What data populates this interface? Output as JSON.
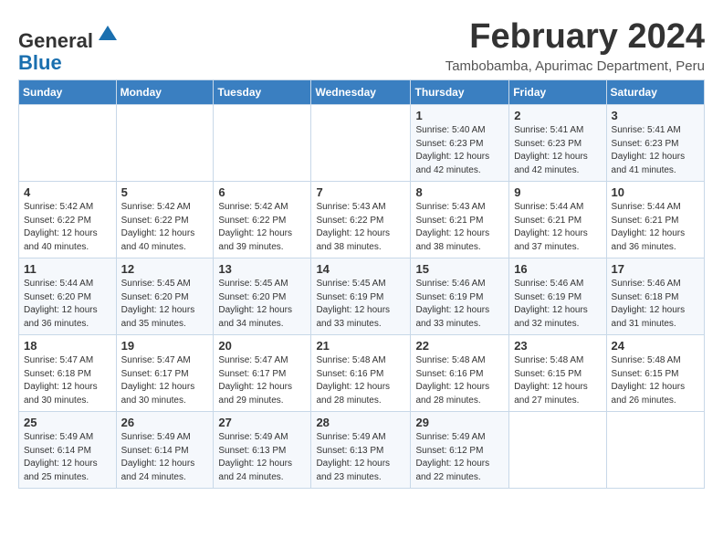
{
  "logo": {
    "general": "General",
    "blue": "Blue"
  },
  "header": {
    "title": "February 2024",
    "subtitle": "Tambobamba, Apurimac Department, Peru"
  },
  "days_of_week": [
    "Sunday",
    "Monday",
    "Tuesday",
    "Wednesday",
    "Thursday",
    "Friday",
    "Saturday"
  ],
  "weeks": [
    {
      "days": [
        {
          "num": "",
          "info": ""
        },
        {
          "num": "",
          "info": ""
        },
        {
          "num": "",
          "info": ""
        },
        {
          "num": "",
          "info": ""
        },
        {
          "num": "1",
          "info": "Sunrise: 5:40 AM\nSunset: 6:23 PM\nDaylight: 12 hours\nand 42 minutes."
        },
        {
          "num": "2",
          "info": "Sunrise: 5:41 AM\nSunset: 6:23 PM\nDaylight: 12 hours\nand 42 minutes."
        },
        {
          "num": "3",
          "info": "Sunrise: 5:41 AM\nSunset: 6:23 PM\nDaylight: 12 hours\nand 41 minutes."
        }
      ]
    },
    {
      "days": [
        {
          "num": "4",
          "info": "Sunrise: 5:42 AM\nSunset: 6:22 PM\nDaylight: 12 hours\nand 40 minutes."
        },
        {
          "num": "5",
          "info": "Sunrise: 5:42 AM\nSunset: 6:22 PM\nDaylight: 12 hours\nand 40 minutes."
        },
        {
          "num": "6",
          "info": "Sunrise: 5:42 AM\nSunset: 6:22 PM\nDaylight: 12 hours\nand 39 minutes."
        },
        {
          "num": "7",
          "info": "Sunrise: 5:43 AM\nSunset: 6:22 PM\nDaylight: 12 hours\nand 38 minutes."
        },
        {
          "num": "8",
          "info": "Sunrise: 5:43 AM\nSunset: 6:21 PM\nDaylight: 12 hours\nand 38 minutes."
        },
        {
          "num": "9",
          "info": "Sunrise: 5:44 AM\nSunset: 6:21 PM\nDaylight: 12 hours\nand 37 minutes."
        },
        {
          "num": "10",
          "info": "Sunrise: 5:44 AM\nSunset: 6:21 PM\nDaylight: 12 hours\nand 36 minutes."
        }
      ]
    },
    {
      "days": [
        {
          "num": "11",
          "info": "Sunrise: 5:44 AM\nSunset: 6:20 PM\nDaylight: 12 hours\nand 36 minutes."
        },
        {
          "num": "12",
          "info": "Sunrise: 5:45 AM\nSunset: 6:20 PM\nDaylight: 12 hours\nand 35 minutes."
        },
        {
          "num": "13",
          "info": "Sunrise: 5:45 AM\nSunset: 6:20 PM\nDaylight: 12 hours\nand 34 minutes."
        },
        {
          "num": "14",
          "info": "Sunrise: 5:45 AM\nSunset: 6:19 PM\nDaylight: 12 hours\nand 33 minutes."
        },
        {
          "num": "15",
          "info": "Sunrise: 5:46 AM\nSunset: 6:19 PM\nDaylight: 12 hours\nand 33 minutes."
        },
        {
          "num": "16",
          "info": "Sunrise: 5:46 AM\nSunset: 6:19 PM\nDaylight: 12 hours\nand 32 minutes."
        },
        {
          "num": "17",
          "info": "Sunrise: 5:46 AM\nSunset: 6:18 PM\nDaylight: 12 hours\nand 31 minutes."
        }
      ]
    },
    {
      "days": [
        {
          "num": "18",
          "info": "Sunrise: 5:47 AM\nSunset: 6:18 PM\nDaylight: 12 hours\nand 30 minutes."
        },
        {
          "num": "19",
          "info": "Sunrise: 5:47 AM\nSunset: 6:17 PM\nDaylight: 12 hours\nand 30 minutes."
        },
        {
          "num": "20",
          "info": "Sunrise: 5:47 AM\nSunset: 6:17 PM\nDaylight: 12 hours\nand 29 minutes."
        },
        {
          "num": "21",
          "info": "Sunrise: 5:48 AM\nSunset: 6:16 PM\nDaylight: 12 hours\nand 28 minutes."
        },
        {
          "num": "22",
          "info": "Sunrise: 5:48 AM\nSunset: 6:16 PM\nDaylight: 12 hours\nand 28 minutes."
        },
        {
          "num": "23",
          "info": "Sunrise: 5:48 AM\nSunset: 6:15 PM\nDaylight: 12 hours\nand 27 minutes."
        },
        {
          "num": "24",
          "info": "Sunrise: 5:48 AM\nSunset: 6:15 PM\nDaylight: 12 hours\nand 26 minutes."
        }
      ]
    },
    {
      "days": [
        {
          "num": "25",
          "info": "Sunrise: 5:49 AM\nSunset: 6:14 PM\nDaylight: 12 hours\nand 25 minutes."
        },
        {
          "num": "26",
          "info": "Sunrise: 5:49 AM\nSunset: 6:14 PM\nDaylight: 12 hours\nand 24 minutes."
        },
        {
          "num": "27",
          "info": "Sunrise: 5:49 AM\nSunset: 6:13 PM\nDaylight: 12 hours\nand 24 minutes."
        },
        {
          "num": "28",
          "info": "Sunrise: 5:49 AM\nSunset: 6:13 PM\nDaylight: 12 hours\nand 23 minutes."
        },
        {
          "num": "29",
          "info": "Sunrise: 5:49 AM\nSunset: 6:12 PM\nDaylight: 12 hours\nand 22 minutes."
        },
        {
          "num": "",
          "info": ""
        },
        {
          "num": "",
          "info": ""
        }
      ]
    }
  ]
}
